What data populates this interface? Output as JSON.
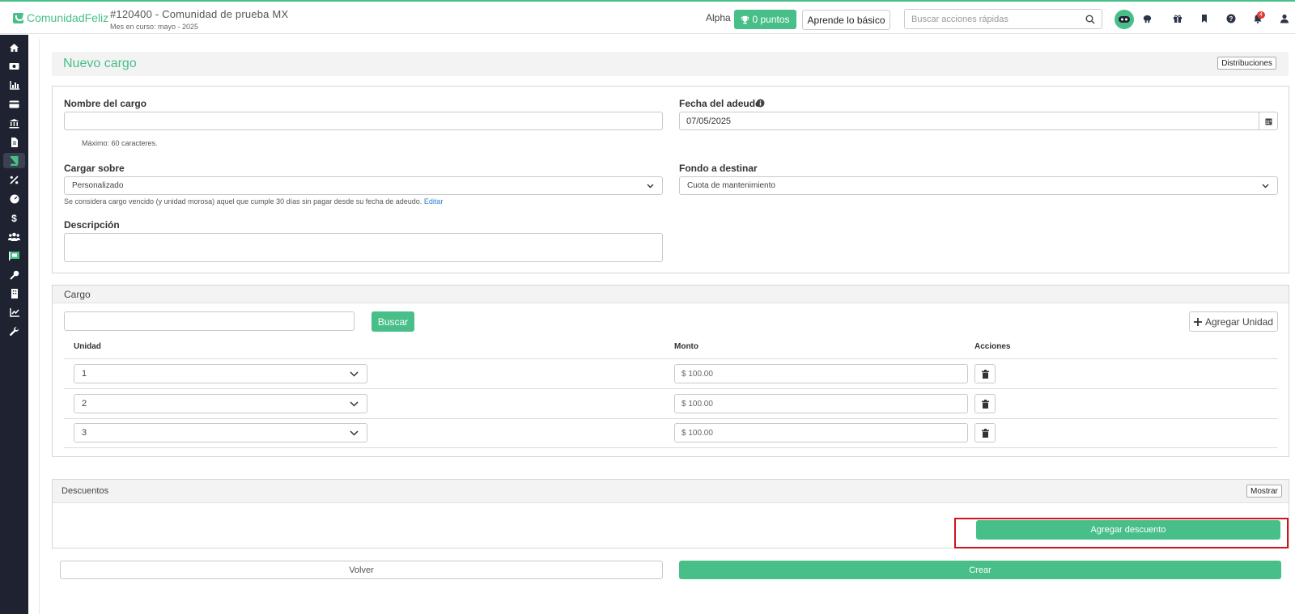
{
  "brand": {
    "name": "ComunidadFeliz",
    "accent": "#48bf89"
  },
  "header": {
    "community_title": "#120400 - Comunidad de prueba MX",
    "current_month": "Mes en curso: mayo - 2025",
    "alpha_label": "Alpha",
    "points_label": "0 puntos",
    "learn_label": "Aprende lo básico",
    "search_placeholder": "Buscar acciones rápidas",
    "notification_count": "4",
    "icons": [
      "avatar-icon",
      "brain-icon",
      "gift-icon",
      "bookmark-icon",
      "help-icon",
      "bell-icon",
      "user-icon"
    ]
  },
  "sidebar": {
    "icons": [
      "home-icon",
      "money-icon",
      "chart-bar-icon",
      "card-icon",
      "bank-icon",
      "document-icon",
      "book-icon",
      "percent-icon",
      "gauge-icon",
      "dollar-icon",
      "users-icon",
      "flag-icon",
      "key-icon",
      "building-icon",
      "chart-line-icon",
      "wrench-icon"
    ],
    "active_index": 6
  },
  "page": {
    "title": "Nuevo cargo",
    "distributions_label": "Distribuciones"
  },
  "form": {
    "name_label": "Nombre del cargo",
    "name_value": "",
    "name_help": "Máximo: 60 caracteres.",
    "due_date_label": "Fecha del adeudo",
    "due_date_value": "07/05/2025",
    "charge_on_label": "Cargar sobre",
    "charge_on_value": "Personalizado",
    "charge_on_help": "Se considera cargo vencido (y unidad morosa) aquel que cumple 30 días sin pagar desde su fecha de adeudo.",
    "charge_on_edit": "Editar",
    "fund_label": "Fondo a destinar",
    "fund_value": "Cuota de mantenimiento",
    "description_label": "Descripción",
    "description_value": ""
  },
  "cargo": {
    "title": "Cargo",
    "search_value": "",
    "search_button": "Buscar",
    "add_unit_button": "Agregar Unidad",
    "columns": [
      "Unidad",
      "Monto",
      "Acciones"
    ],
    "rows": [
      {
        "unit": "1",
        "amount": "$ 100.00"
      },
      {
        "unit": "2",
        "amount": "$ 100.00"
      },
      {
        "unit": "3",
        "amount": "$ 100.00"
      }
    ]
  },
  "discounts": {
    "title": "Descuentos",
    "show_button": "Mostrar",
    "add_button": "Agregar descuento"
  },
  "footer": {
    "back_button": "Volver",
    "create_button": "Crear"
  }
}
